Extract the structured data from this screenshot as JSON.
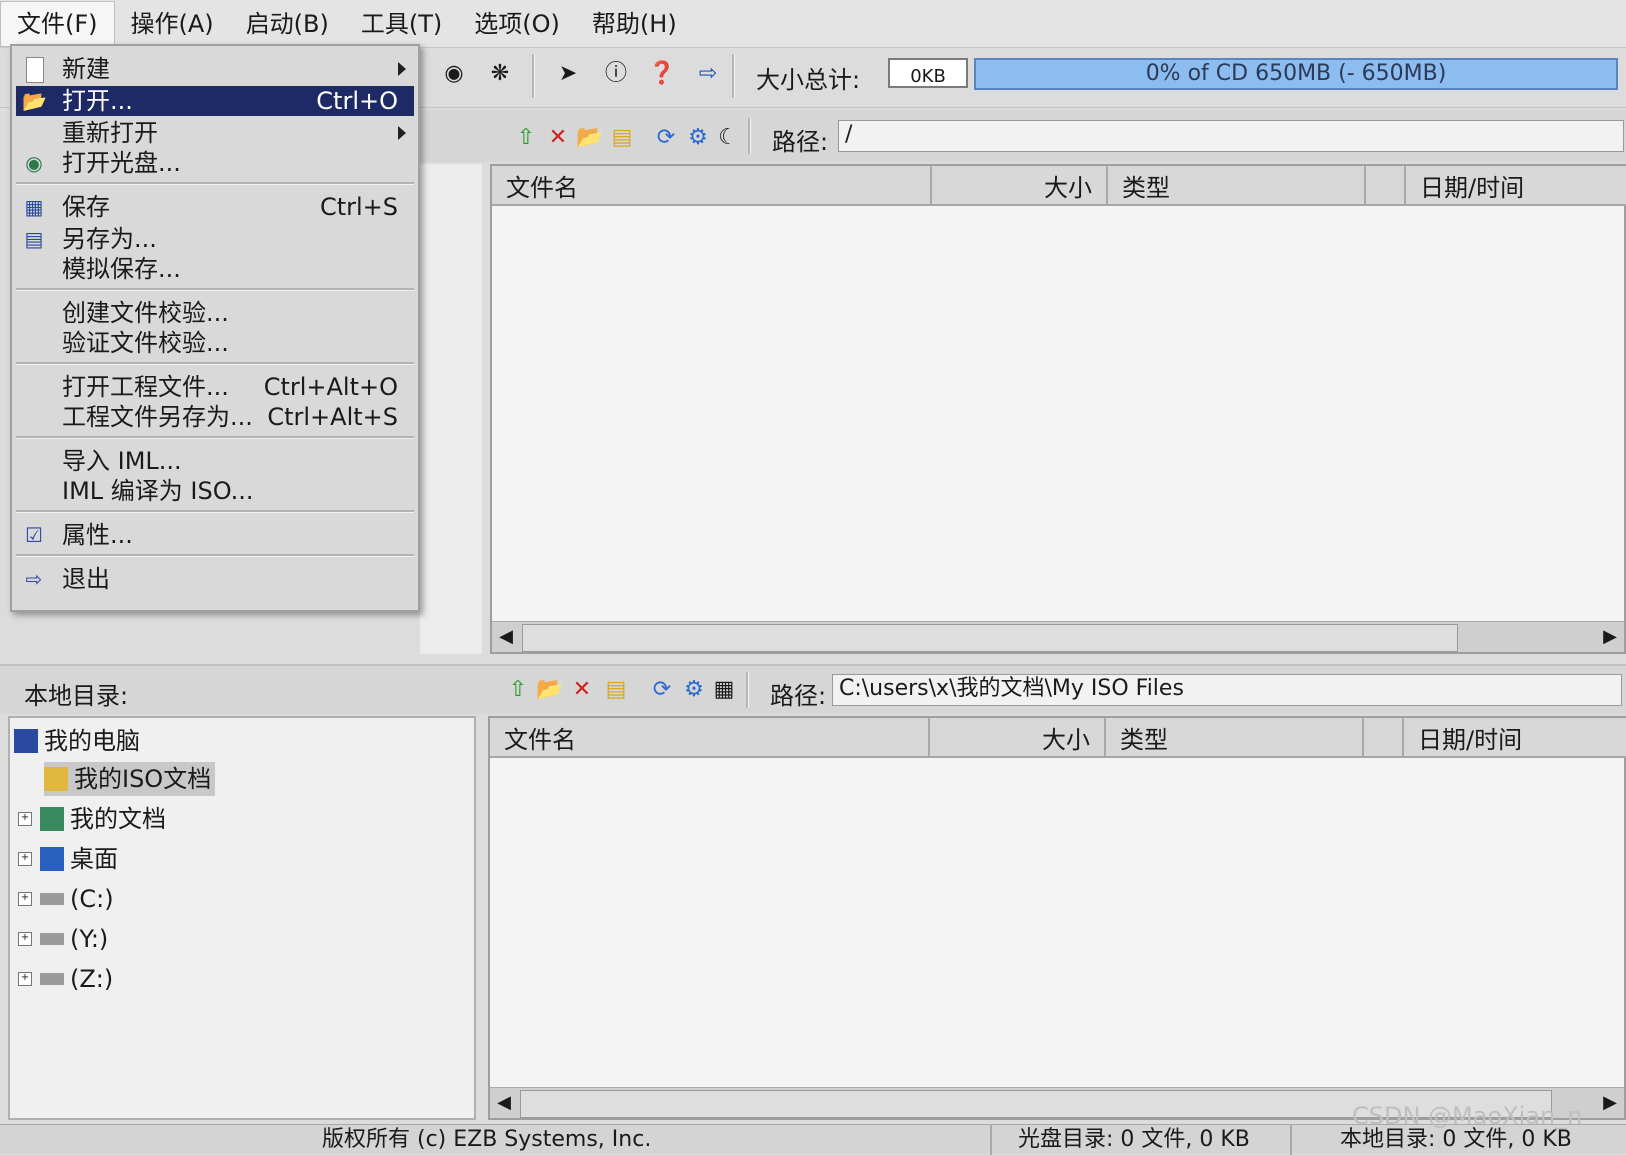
{
  "menubar": {
    "items": [
      "文件(F)",
      "操作(A)",
      "启动(B)",
      "工具(T)",
      "选项(O)",
      "帮助(H)"
    ]
  },
  "toolbar": {
    "size_label": "大小总计:",
    "size_value": "0KB",
    "capacity_text": "0% of CD 650MB (- 650MB)"
  },
  "file_menu": {
    "new": "新建",
    "open": "打开...",
    "open_shortcut": "Ctrl+O",
    "reopen": "重新打开",
    "open_disc": "打开光盘...",
    "save": "保存",
    "save_shortcut": "Ctrl+S",
    "save_as": "另存为...",
    "mock_save": "模拟保存...",
    "create_checksum": "创建文件校验...",
    "verify_checksum": "验证文件校验...",
    "open_project": "打开工程文件...",
    "open_project_shortcut": "Ctrl+Alt+O",
    "save_project_as": "工程文件另存为...",
    "save_project_shortcut": "Ctrl+Alt+S",
    "import_iml": "导入 IML...",
    "compile_iml": "IML 编译为 ISO...",
    "properties": "属性...",
    "exit": "退出"
  },
  "iso_pane": {
    "path_label": "路径:",
    "path_value": "/",
    "columns": [
      "文件名",
      "大小",
      "类型",
      "日期/时间"
    ]
  },
  "local_pane": {
    "title": "本地目录:",
    "path_label": "路径:",
    "path_value": "C:\\users\\x\\我的文档\\My ISO Files",
    "columns": [
      "文件名",
      "大小",
      "类型",
      "日期/时间"
    ],
    "tree": [
      {
        "label": "我的电脑"
      },
      {
        "label": "我的ISO文档"
      },
      {
        "label": "我的文档"
      },
      {
        "label": "桌面"
      },
      {
        "label": "(C:)"
      },
      {
        "label": "(Y:)"
      },
      {
        "label": "(Z:)"
      }
    ]
  },
  "statusbar": {
    "copyright": "版权所有 (c) EZB Systems, Inc.",
    "disc_dir": "光盘目录: 0 文件, 0 KB",
    "local_dir": "本地目录: 0 文件, 0 KB",
    "watermark": "CSDN @MaoXian_n"
  },
  "colors": {
    "selection": "#1e2a66",
    "progress": "#8cbcf0"
  }
}
